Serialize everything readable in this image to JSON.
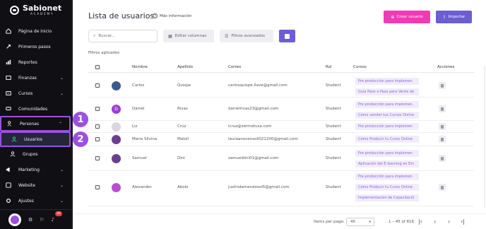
{
  "brand": {
    "name": "Sabionet",
    "sub": "ACADEMY"
  },
  "nav": {
    "items": [
      {
        "label": "Página de Inicio",
        "icon": "home-icon",
        "chevron": false
      },
      {
        "label": "Primeros pasos",
        "icon": "rocket-icon",
        "chevron": false
      },
      {
        "label": "Reportes",
        "icon": "chart-icon",
        "chevron": false
      },
      {
        "label": "Finanzas",
        "icon": "wallet-icon",
        "chevron": true
      },
      {
        "label": "Cursos",
        "icon": "course-icon",
        "chevron": true
      },
      {
        "label": "Comunidades",
        "icon": "chat-icon",
        "chevron": false
      },
      {
        "label": "Personas",
        "icon": "people-icon",
        "chevron": true
      },
      {
        "label": "Usuarios",
        "icon": "user-icon",
        "chevron": false
      },
      {
        "label": "Grupos",
        "icon": "group-icon",
        "chevron": false
      },
      {
        "label": "Marketing",
        "icon": "megaphone-icon",
        "chevron": true
      },
      {
        "label": "Website",
        "icon": "globe-icon",
        "chevron": true
      },
      {
        "label": "Ajustes",
        "icon": "gear-icon",
        "chevron": true
      }
    ],
    "callouts": [
      "1",
      "2"
    ],
    "notification_count": "30"
  },
  "header": {
    "title": "Lista de usuarios",
    "more_info": "Más información",
    "create_user": "Crear usuario",
    "import": "Importar"
  },
  "toolbar": {
    "search_placeholder": "Buscar...",
    "edit_columns": "Editar columnas",
    "advanced_filters": "Filtros avanzados",
    "filters_applied": "Filtros aplicados"
  },
  "table": {
    "columns": [
      "Nombre",
      "Apellido",
      "Correo",
      "Rol",
      "Cursos",
      "Acciones"
    ],
    "rows": [
      {
        "name": "Carlos",
        "last": "Quispe",
        "email": "carlosquispe.llave@gmail.com",
        "role": "Student",
        "avatar_color": "#3b5b8c",
        "avatar_letter": "",
        "courses": [
          "Pre producción para implemen",
          "Guía Paso a Paso para Venta de"
        ]
      },
      {
        "name": "Daniel",
        "last": "Rivas",
        "email": "danielrivas23@gmail.com",
        "role": "Student",
        "avatar_color": "#9b3fd6",
        "avatar_letter": "D",
        "courses": [
          "Pre producción para implemen",
          "Cómo vender tus Cursos Online"
        ]
      },
      {
        "name": "Liz",
        "last": "Cruz",
        "email": "lcruz@zermatusa.com",
        "role": "Student",
        "avatar_color": "#d8d8de",
        "avatar_letter": "",
        "courses": [
          "Pre producción para implemen"
        ]
      },
      {
        "name": "Maria Silvina",
        "last": "Maiolí",
        "email": "lauraanocensoli021200@gmail.com",
        "role": "Student",
        "avatar_color": "#6b3f8f",
        "avatar_letter": "",
        "courses": [
          "Cómo Producir tu Curso Online"
        ]
      },
      {
        "name": "Samuel",
        "last": "Dini",
        "email": "samueldini01@gmail.com",
        "role": "Student",
        "avatar_color": "#6b3f8f",
        "avatar_letter": "",
        "courses": [
          "Pre producción para implemen",
          "Aplicación del E-learning en Em"
        ]
      },
      {
        "name": "Alexander",
        "last": "Abolo",
        "email": "justindemendozol5@gmail.com",
        "role": "Student",
        "avatar_color": "#b84fd1",
        "avatar_letter": "",
        "courses": [
          "Pre producción para implemen",
          "Cómo Producir tu Curso Online",
          "Implementación de Capacitació"
        ]
      }
    ]
  },
  "pagination": {
    "items_per_page_label": "Items per page:",
    "items_per_page": "45",
    "range": "1 – 45 of 816",
    "first": "|‹",
    "prev": "‹",
    "next": "›",
    "last": "›|"
  }
}
